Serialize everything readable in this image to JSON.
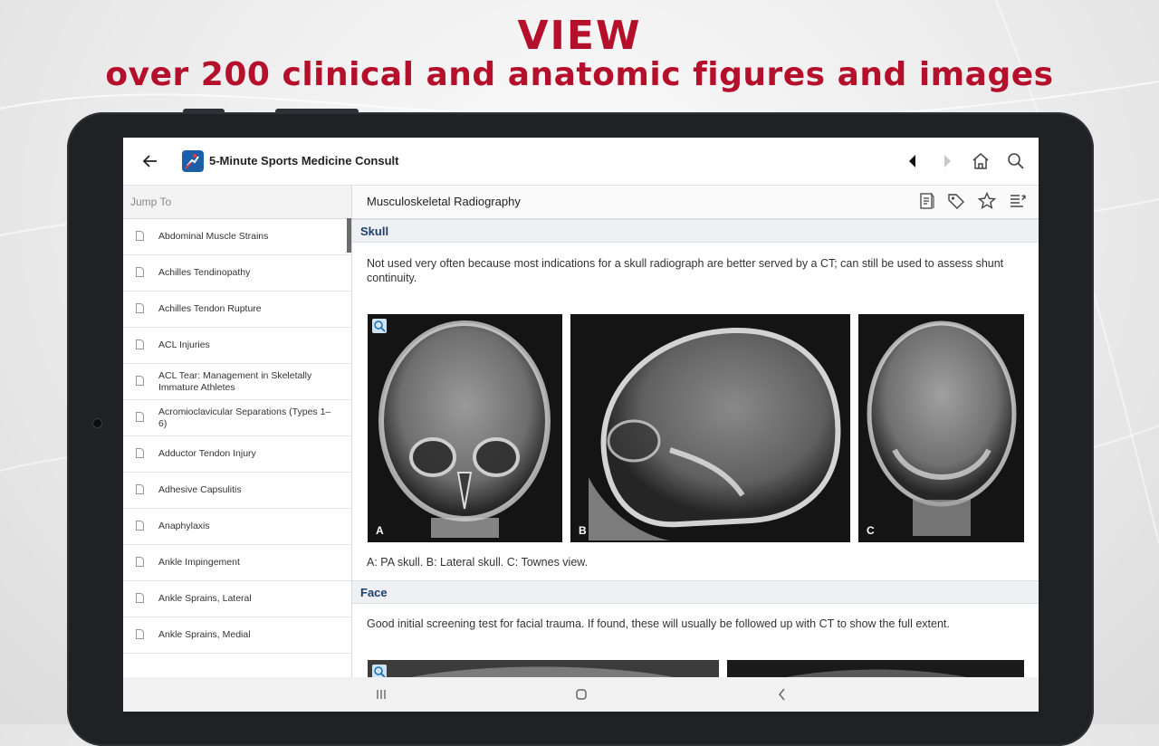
{
  "banner": {
    "line1": "VIEW",
    "line2": "over 200 clinical and anatomic figures and images",
    "color": "#b5102b"
  },
  "appbar": {
    "back_icon": "back-arrow-icon",
    "logo_icon": "app-logo-icon",
    "title": "5-Minute Sports Medicine Consult",
    "icons": [
      "previous-icon",
      "next-icon",
      "home-icon",
      "search-icon"
    ]
  },
  "sidebar": {
    "jump_placeholder": "Jump To",
    "items": [
      {
        "label": "Abdominal Muscle Strains"
      },
      {
        "label": "Achilles Tendinopathy"
      },
      {
        "label": "Achilles Tendon Rupture"
      },
      {
        "label": "ACL Injuries"
      },
      {
        "label": "ACL Tear: Management in Skeletally Immature Athletes"
      },
      {
        "label": "Acromioclavicular Separations (Types 1–6)"
      },
      {
        "label": "Adductor Tendon Injury"
      },
      {
        "label": "Adhesive Capsulitis"
      },
      {
        "label": "Anaphylaxis"
      },
      {
        "label": "Ankle Impingement"
      },
      {
        "label": "Ankle Sprains, Lateral"
      },
      {
        "label": "Ankle Sprains, Medial"
      }
    ]
  },
  "content": {
    "title": "Musculoskeletal Radiography",
    "toolbar_icons": [
      "notes-icon",
      "tag-icon",
      "star-icon",
      "outline-icon"
    ],
    "sections": [
      {
        "heading": "Skull",
        "text": "Not used very often because most indications for a skull radiograph are better served by a CT; can still be used to assess shunt continuity.",
        "image_labels": [
          "A",
          "B",
          "C"
        ],
        "caption": "A: PA skull.  B: Lateral skull.  C: Townes view."
      },
      {
        "heading": "Face",
        "text": "Good initial screening test for facial trauma. If found, these will usually be followed up with CT to show the full extent."
      }
    ]
  },
  "system_nav": {
    "icons": [
      "recent-apps-icon",
      "home-circle-icon",
      "system-back-icon"
    ]
  }
}
